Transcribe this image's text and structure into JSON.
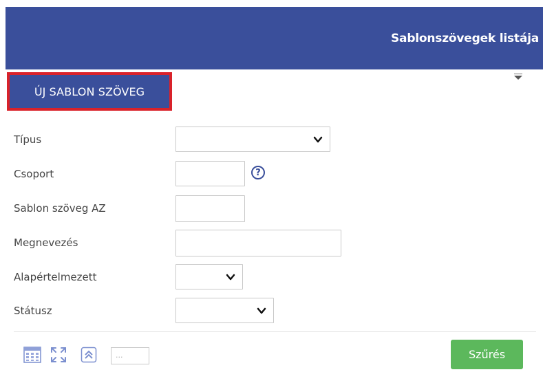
{
  "header": {
    "title": "Sablonszövegek listája"
  },
  "new_button": {
    "label": "ÚJ SABLON SZÖVEG"
  },
  "form": {
    "tipus": {
      "label": "Típus",
      "value": ""
    },
    "csoport": {
      "label": "Csoport",
      "value": "",
      "help_icon": "question-circle-icon",
      "help_glyph": "?"
    },
    "sablon_az": {
      "label": "Sablon szöveg AZ",
      "value": ""
    },
    "megnevezes": {
      "label": "Megnevezés",
      "value": ""
    },
    "alapertelmezett": {
      "label": "Alapértelmezett",
      "value": ""
    },
    "statusz": {
      "label": "Státusz",
      "value": ""
    }
  },
  "toolbar": {
    "icons": [
      "calendar-grid-icon",
      "expand-icon",
      "scroll-top-icon"
    ],
    "page_input_placeholder": "...",
    "filter_label": "Szűrés"
  },
  "colors": {
    "primary": "#3a4f9b",
    "highlight": "#d9222a",
    "success": "#5cb85c"
  }
}
